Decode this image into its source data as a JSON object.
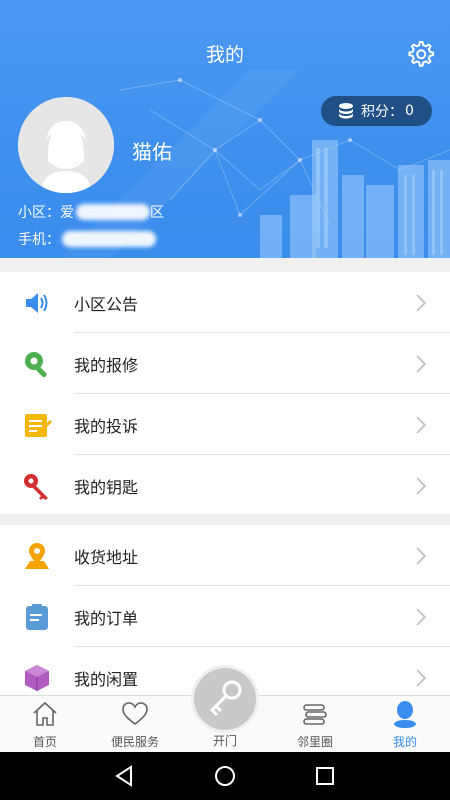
{
  "page": {
    "title": "我的"
  },
  "profile": {
    "username": "猫佑",
    "community_label": "小区：",
    "community_value_visible_start": "爱",
    "community_value_visible_end": "区",
    "phone_label": "手机："
  },
  "points": {
    "label": "积分：",
    "value": "0"
  },
  "menu_group_1": [
    {
      "id": "notice",
      "label": "小区公告",
      "icon": "speaker-icon"
    },
    {
      "id": "repair",
      "label": "我的报修",
      "icon": "wrench-icon"
    },
    {
      "id": "complaint",
      "label": "我的投诉",
      "icon": "note-icon"
    },
    {
      "id": "keys",
      "label": "我的钥匙",
      "icon": "key-icon"
    }
  ],
  "menu_group_2": [
    {
      "id": "address",
      "label": "收货地址",
      "icon": "location-pin-icon"
    },
    {
      "id": "orders",
      "label": "我的订单",
      "icon": "clipboard-icon"
    },
    {
      "id": "idle",
      "label": "我的闲置",
      "icon": "box-icon"
    }
  ],
  "tabs": [
    {
      "id": "home",
      "label": "首页",
      "icon": "home-icon"
    },
    {
      "id": "services",
      "label": "便民服务",
      "icon": "heart-icon"
    },
    {
      "id": "door",
      "label": "开门",
      "icon": "key-icon"
    },
    {
      "id": "neighbors",
      "label": "邻里圈",
      "icon": "list-icon"
    },
    {
      "id": "mine",
      "label": "我的",
      "icon": "person-icon",
      "active": true
    }
  ],
  "colors": {
    "header_blue": "#3f90ee",
    "accent": "#3a8ded",
    "badge_bg": "#1f4f85"
  }
}
